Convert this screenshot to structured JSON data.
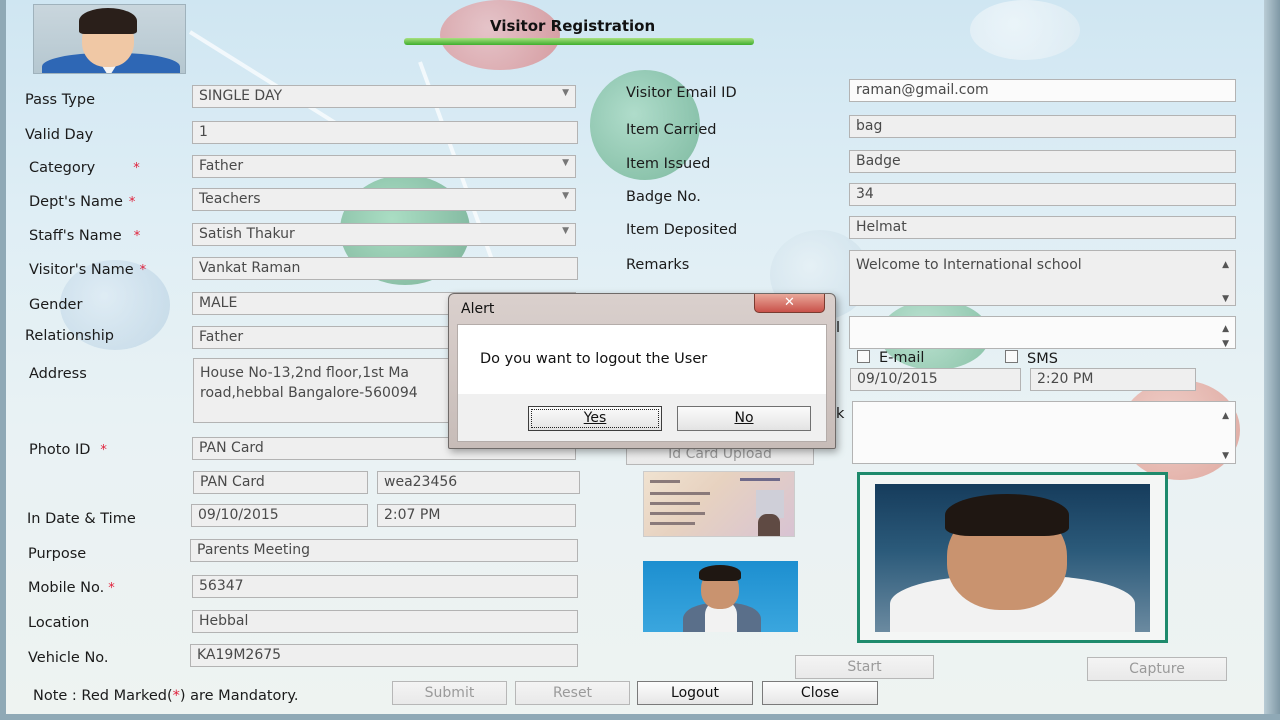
{
  "form": {
    "title": "Visitor Registration",
    "note_prefix": "Note : Red Marked(",
    "note_star": "*",
    "note_suffix": ") are Mandatory.",
    "required_mark": "*",
    "left": {
      "pass_type": {
        "label": "Pass Type",
        "value": "SINGLE DAY"
      },
      "valid_day": {
        "label": "Valid Day",
        "value": "1"
      },
      "category": {
        "label": "Category",
        "value": "Father"
      },
      "dept_name": {
        "label": "Dept's Name",
        "value": "Teachers"
      },
      "staff_name": {
        "label": "Staff's Name",
        "value": "Satish Thakur"
      },
      "visitor_name": {
        "label": "Visitor's Name",
        "value": "Vankat Raman"
      },
      "gender": {
        "label": "Gender",
        "value": "MALE"
      },
      "relationship": {
        "label": "Relationship",
        "value": "Father"
      },
      "address": {
        "label": "Address",
        "line1": "House No-13,2nd floor,1st Ma",
        "line2": "road,hebbal Bangalore-560094"
      },
      "photo_id": {
        "label": "Photo ID",
        "value": "PAN Card",
        "type_value": "PAN Card",
        "number_value": "wea23456"
      },
      "in_date_time": {
        "label": "In Date & Time",
        "date": "09/10/2015",
        "time": "2:07 PM"
      },
      "purpose": {
        "label": "Purpose",
        "value": "Parents Meeting"
      },
      "mobile": {
        "label": "Mobile No.",
        "value": "56347"
      },
      "location": {
        "label": "Location",
        "value": "Hebbal"
      },
      "vehicle": {
        "label": "Vehicle No.",
        "value": "KA19M2675"
      }
    },
    "right": {
      "email": {
        "label": "Visitor Email ID",
        "value": "raman@gmail.com"
      },
      "item_carried": {
        "label": "Item Carried",
        "value": "bag"
      },
      "item_issued": {
        "label": "Item Issued",
        "value": "Badge"
      },
      "badge_no": {
        "label": "Badge No.",
        "value": "34"
      },
      "item_deposited": {
        "label": "Item Deposited",
        "value": "Helmat"
      },
      "remarks": {
        "label": "Remarks",
        "value": "Welcome to International school"
      },
      "partial_label_1": "l",
      "partial_label_2": "k",
      "email_check_label": "E-mail",
      "sms_check_label": "SMS",
      "out_date": "09/10/2015",
      "out_time": "2:20 PM",
      "id_card_upload": "Id Card Upload"
    },
    "buttons": {
      "submit": "Submit",
      "reset": "Reset",
      "logout": "Logout",
      "close": "Close",
      "start": "Start",
      "capture": "Capture"
    }
  },
  "dialog": {
    "title": "Alert",
    "close_glyph": "✕",
    "message": "Do you want to logout the User",
    "yes": "Yes",
    "no": "No"
  },
  "colors": {
    "required": "#e0203a",
    "photo_frame": "#1e8a6c",
    "title_bar": "#3fae2e"
  }
}
